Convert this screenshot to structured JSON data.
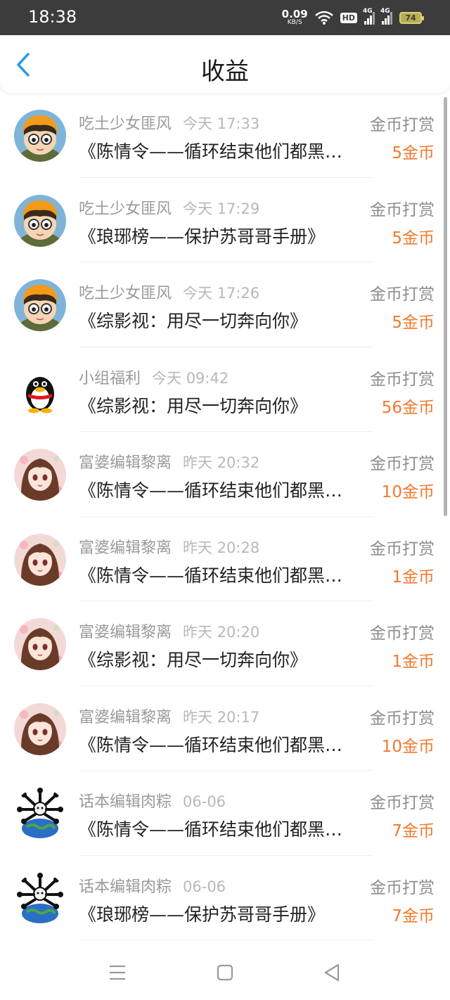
{
  "status_bar": {
    "time": "18:38",
    "speed_value": "0.09",
    "speed_unit": "KB/S",
    "hd_label": "HD",
    "sim1_label": "4G",
    "sim2_label": "4G",
    "battery": "74"
  },
  "header": {
    "title": "收益"
  },
  "records": [
    {
      "sender": "吃土少女匪风",
      "time": "今天 17:33",
      "type": "金币打赏",
      "title": "《陈情令——循环结束他们都黑化了》",
      "amount": "5金币",
      "avatar": "girl-hat"
    },
    {
      "sender": "吃土少女匪风",
      "time": "今天 17:29",
      "type": "金币打赏",
      "title": "《琅琊榜——保护苏哥哥手册》",
      "amount": "5金币",
      "avatar": "girl-hat"
    },
    {
      "sender": "吃土少女匪风",
      "time": "今天 17:26",
      "type": "金币打赏",
      "title": "《综影视：用尽一切奔向你》",
      "amount": "5金币",
      "avatar": "girl-hat"
    },
    {
      "sender": "小组福利",
      "time": "今天 09:42",
      "type": "金币打赏",
      "title": "《综影视：用尽一切奔向你》",
      "amount": "56金币",
      "avatar": "penguin"
    },
    {
      "sender": "富婆编辑黎离",
      "time": "昨天 20:32",
      "type": "金币打赏",
      "title": "《陈情令——循环结束他们都黑化了》",
      "amount": "10金币",
      "avatar": "anime-girl"
    },
    {
      "sender": "富婆编辑黎离",
      "time": "昨天 20:28",
      "type": "金币打赏",
      "title": "《陈情令——循环结束他们都黑化了》",
      "amount": "1金币",
      "avatar": "anime-girl"
    },
    {
      "sender": "富婆编辑黎离",
      "time": "昨天 20:20",
      "type": "金币打赏",
      "title": "《综影视：用尽一切奔向你》",
      "amount": "1金币",
      "avatar": "anime-girl"
    },
    {
      "sender": "富婆编辑黎离",
      "time": "昨天 20:17",
      "type": "金币打赏",
      "title": "《陈情令——循环结束他们都黑化了》",
      "amount": "10金币",
      "avatar": "anime-girl"
    },
    {
      "sender": "话本编辑肉粽",
      "time": "06-06",
      "type": "金币打赏",
      "title": "《陈情令——循环结束他们都黑化了》",
      "amount": "7金币",
      "avatar": "globe-figure"
    },
    {
      "sender": "话本编辑肉粽",
      "time": "06-06",
      "type": "金币打赏",
      "title": "《琅琊榜——保护苏哥哥手册》",
      "amount": "7金币",
      "avatar": "globe-figure"
    }
  ],
  "colors": {
    "amount": "#ef7a2d",
    "back_arrow": "#2b9be6",
    "status_bar": "#3c3c3c"
  }
}
